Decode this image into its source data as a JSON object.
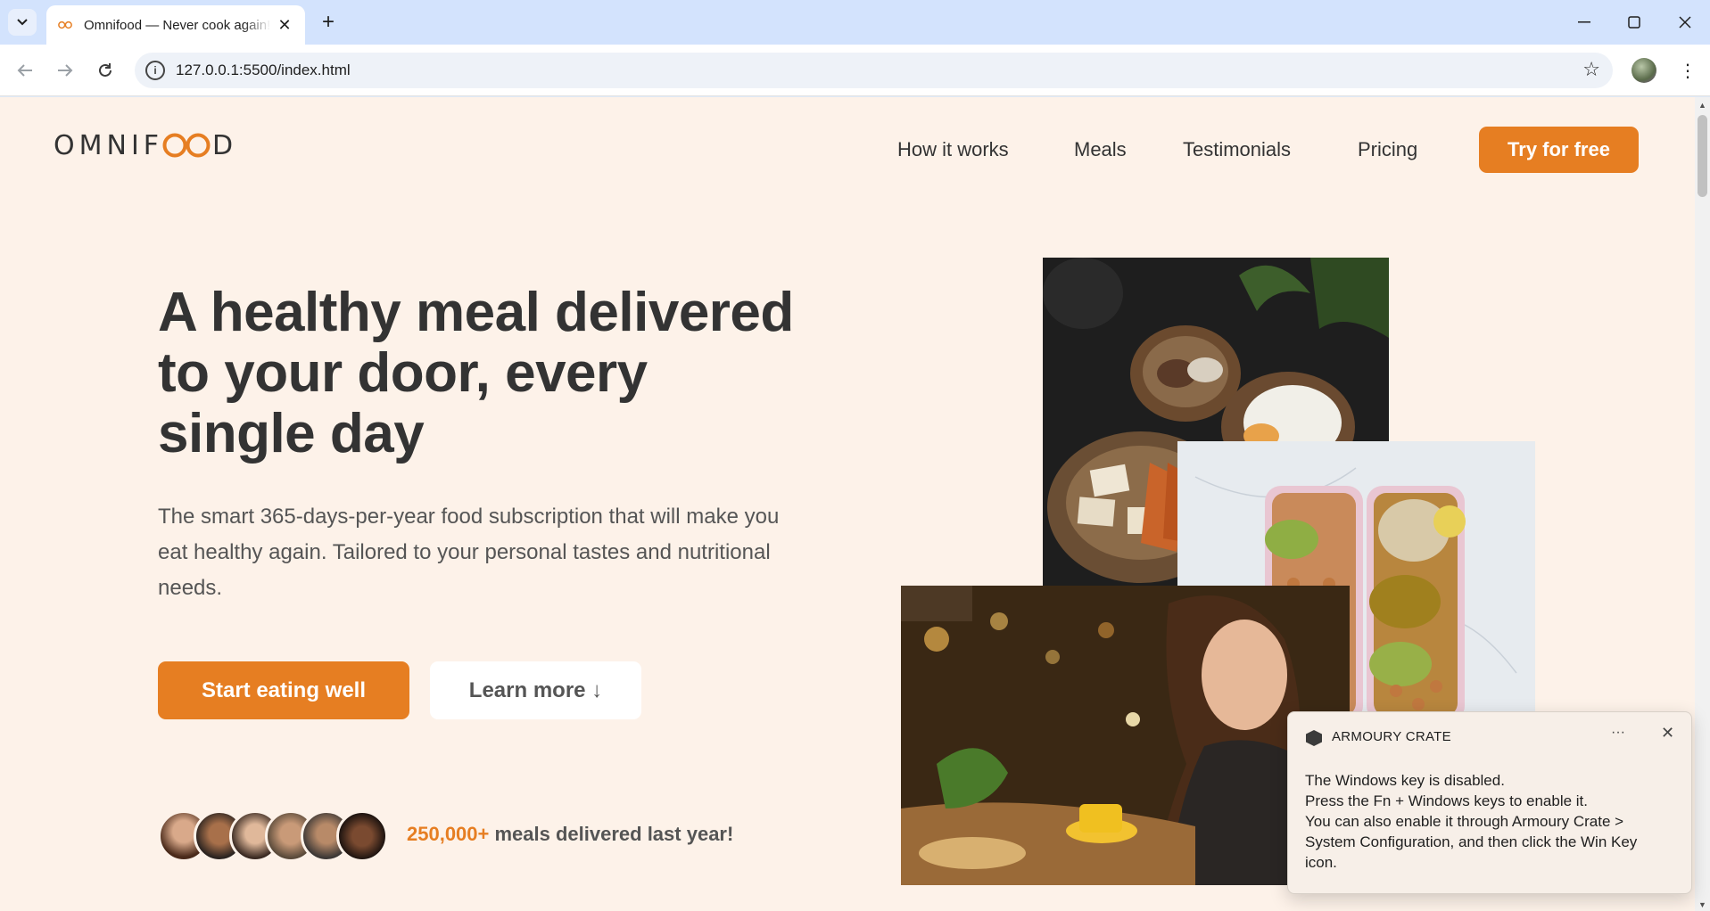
{
  "browser": {
    "tab_title": "Omnifood — Never cook again!",
    "url": "127.0.0.1:5500/index.html"
  },
  "site": {
    "logo_left": "OMNIF",
    "logo_right": "D",
    "nav": [
      "How it works",
      "Meals",
      "Testimonials",
      "Pricing"
    ],
    "cta": "Try for free",
    "hero": {
      "title": "A healthy meal delivered to your door, every single day",
      "description": "The smart 365-days-per-year food subscription that will make you eat healthy again. Tailored to your personal tastes and nutritional needs.",
      "primary_button": "Start eating well",
      "secondary_button": "Learn more ↓",
      "delivered_count": "250,000+",
      "delivered_text": " meals delivered last year!"
    }
  },
  "notification": {
    "app": "ARMOURY CRATE",
    "lines": [
      "The Windows key is disabled.",
      "Press the Fn + Windows keys to enable it.",
      "You can also enable it through Armoury Crate >",
      "System Configuration, and then click the Win Key",
      "icon."
    ]
  },
  "colors": {
    "accent": "#e67e22",
    "background": "#fdf2e9",
    "text": "#333333"
  }
}
